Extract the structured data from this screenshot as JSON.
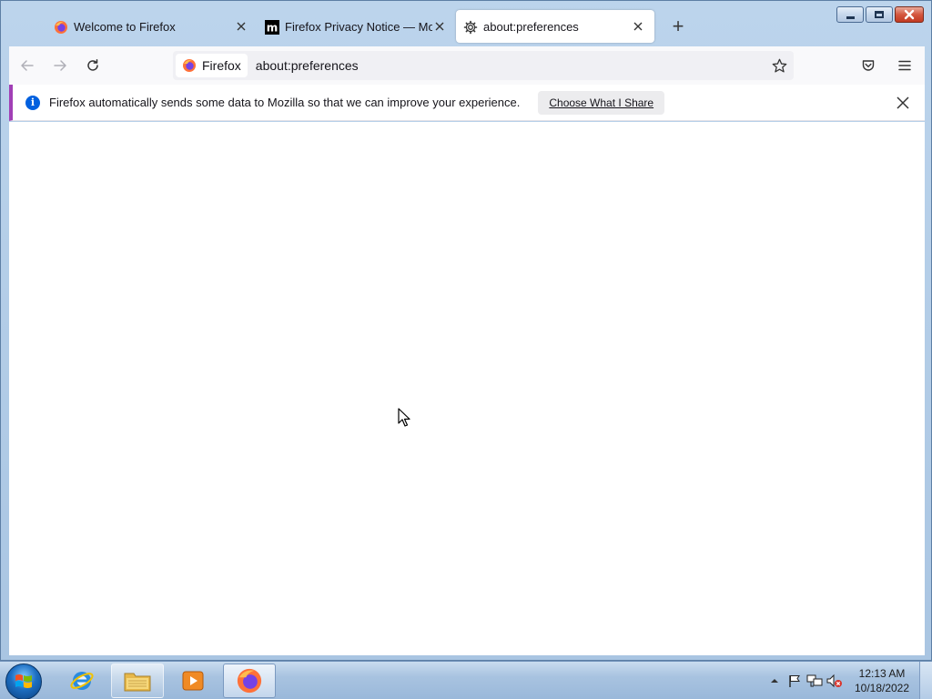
{
  "browser": {
    "tabs": [
      {
        "label": "Welcome to Firefox",
        "icon": "firefox-icon",
        "active": false
      },
      {
        "label": "Firefox Privacy Notice — Mozilla",
        "icon": "mozilla-icon",
        "active": false
      },
      {
        "label": "about:preferences",
        "icon": "gear-icon",
        "active": true
      }
    ],
    "new_tab_label": "+",
    "identity_label": "Firefox",
    "url": "about:preferences"
  },
  "notification": {
    "message": "Firefox automatically sends some data to Mozilla so that we can improve your experience.",
    "button_label": "Choose What I Share"
  },
  "taskbar": {
    "time": "12:13 AM",
    "date": "10/18/2022"
  },
  "colors": {
    "notification_accent": "#a13fb5",
    "info_icon": "#0060df"
  }
}
